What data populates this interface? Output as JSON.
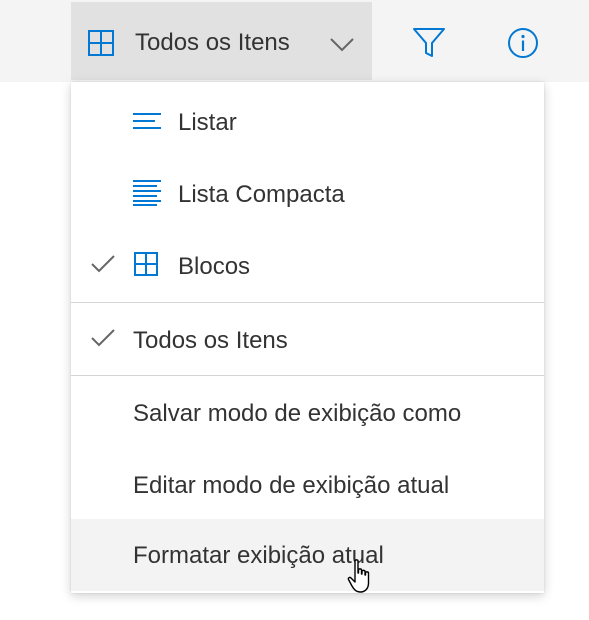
{
  "toolbar": {
    "view_switcher": {
      "label": "Todos os Itens",
      "icon": "grid-icon"
    },
    "filter_icon": "filter-icon",
    "info_icon": "info-icon"
  },
  "menu": {
    "layout_items": [
      {
        "label": "Listar",
        "icon": "list-icon",
        "checked": false
      },
      {
        "label": "Lista Compacta",
        "icon": "compact-list-icon",
        "checked": false
      },
      {
        "label": "Blocos",
        "icon": "tiles-icon",
        "checked": true
      }
    ],
    "view_items": [
      {
        "label": "Todos os Itens",
        "checked": true
      }
    ],
    "action_items": [
      {
        "label": "Salvar modo de exibição como"
      },
      {
        "label": "Editar modo de exibição atual"
      },
      {
        "label": "Formatar exibição atual",
        "hovered": true
      }
    ]
  },
  "colors": {
    "accent": "#0078d4",
    "toolbar_bg": "#f4f4f4",
    "switcher_bg": "#e1e1e1",
    "hover_bg": "#f3f3f3",
    "divider": "#d4d4d4"
  }
}
